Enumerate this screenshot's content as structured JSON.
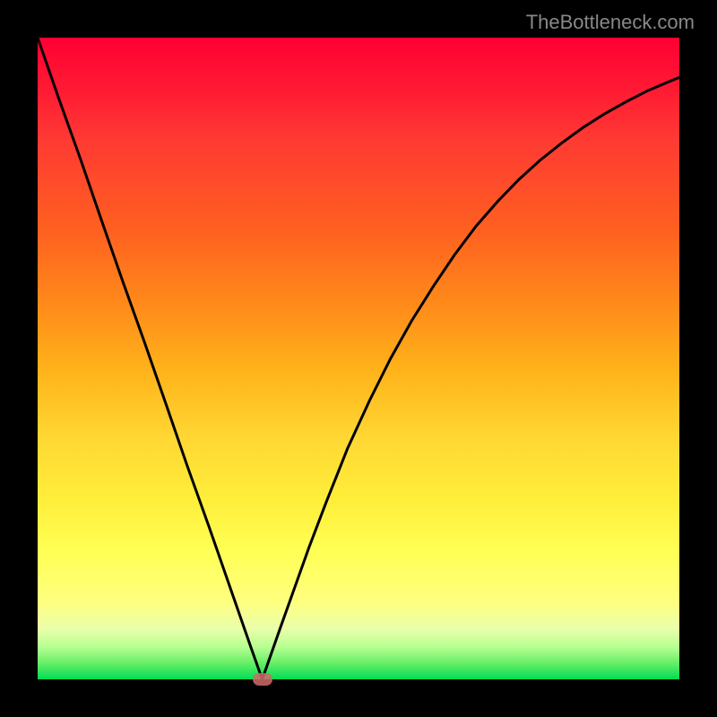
{
  "watermark": "TheBottleneck.com",
  "chart_data": {
    "type": "line",
    "title": "",
    "xlabel": "",
    "ylabel": "",
    "xlim": [
      0,
      1
    ],
    "ylim": [
      0,
      1
    ],
    "series": [
      {
        "name": "curve",
        "x": [
          0.0,
          0.033,
          0.067,
          0.1,
          0.133,
          0.167,
          0.2,
          0.233,
          0.267,
          0.3,
          0.333,
          0.35,
          0.377,
          0.423,
          0.45,
          0.483,
          0.517,
          0.55,
          0.583,
          0.617,
          0.65,
          0.683,
          0.717,
          0.75,
          0.783,
          0.817,
          0.85,
          0.883,
          0.917,
          0.95,
          0.983,
          1.0
        ],
        "y": [
          1.0,
          0.905,
          0.81,
          0.714,
          0.619,
          0.524,
          0.429,
          0.333,
          0.238,
          0.143,
          0.048,
          0.0,
          0.077,
          0.206,
          0.277,
          0.36,
          0.434,
          0.5,
          0.559,
          0.613,
          0.662,
          0.706,
          0.745,
          0.779,
          0.809,
          0.836,
          0.86,
          0.881,
          0.9,
          0.917,
          0.931,
          0.938
        ]
      }
    ],
    "marker": {
      "x": 0.35,
      "y": 0.0,
      "color": "#d16a6a"
    },
    "gradient_stops": [
      {
        "pos": 0.0,
        "color": "#ff0033"
      },
      {
        "pos": 0.5,
        "color": "#ffcc33"
      },
      {
        "pos": 0.8,
        "color": "#ffff55"
      },
      {
        "pos": 1.0,
        "color": "#00dd55"
      }
    ]
  }
}
